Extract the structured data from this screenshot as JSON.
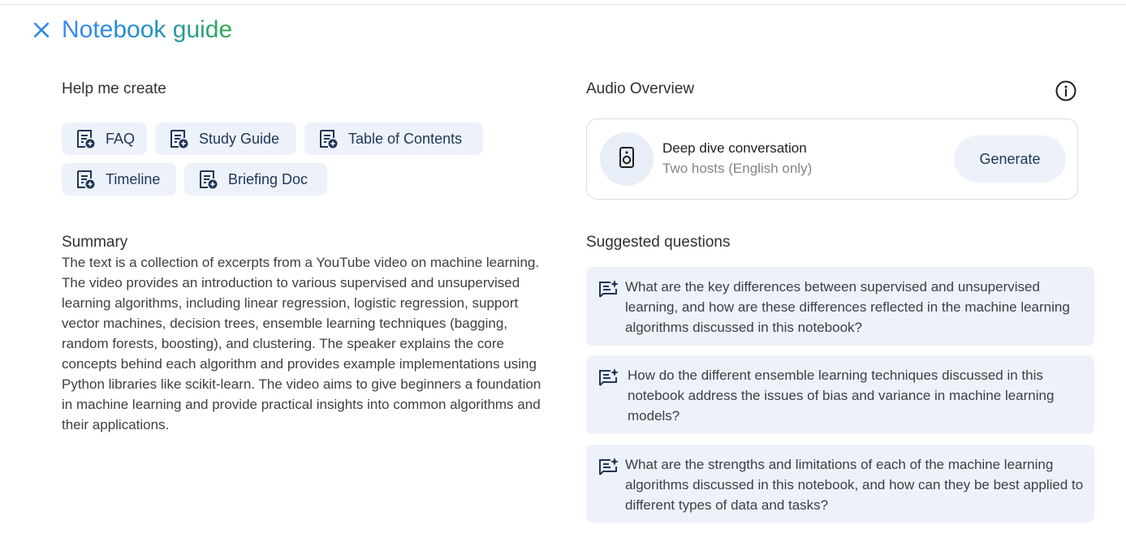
{
  "header": {
    "title": "Notebook guide",
    "icon": "sparkle-asterisk-icon"
  },
  "help_me_create": {
    "heading": "Help me create",
    "buttons": [
      {
        "label": "FAQ",
        "icon": "note-add-icon"
      },
      {
        "label": "Study Guide",
        "icon": "note-add-icon"
      },
      {
        "label": "Table of Contents",
        "icon": "note-add-icon"
      },
      {
        "label": "Timeline",
        "icon": "note-add-icon"
      },
      {
        "label": "Briefing Doc",
        "icon": "note-add-icon"
      }
    ]
  },
  "summary": {
    "heading": "Summary",
    "text": "The text is a collection of excerpts from a YouTube video on machine learning. The video provides an introduction to various supervised and unsupervised learning algorithms, including linear regression, logistic regression, support vector machines, decision trees, ensemble learning techniques (bagging, random forests, boosting), and clustering. The speaker explains the core concepts behind each algorithm and provides example implementations using Python libraries like scikit-learn. The video aims to give beginners a foundation in machine learning and provide practical insights into common algorithms and their applications."
  },
  "audio_overview": {
    "heading": "Audio Overview",
    "title": "Deep dive conversation",
    "subtitle": "Two hosts (English only)",
    "generate_label": "Generate",
    "icon": "speaker-icon",
    "info_icon": "info-icon"
  },
  "suggested_questions": {
    "heading": "Suggested questions",
    "items": [
      {
        "text": "What are the key differences between supervised and unsupervised learning, and how are these differences reflected in the machine learning algorithms discussed in this notebook?"
      },
      {
        "text": "How do the different ensemble learning techniques discussed in this notebook address the issues of bias and variance in machine learning models?"
      },
      {
        "text": "What are the strengths and limitations of each of the machine learning algorithms discussed in this notebook, and how can they be best applied to different types of data and tasks?"
      }
    ]
  },
  "colors": {
    "chip_bg": "#edf2fa",
    "chip_text": "#1f3657",
    "title_gradient_start": "#4285f4",
    "title_gradient_end": "#34a853"
  }
}
